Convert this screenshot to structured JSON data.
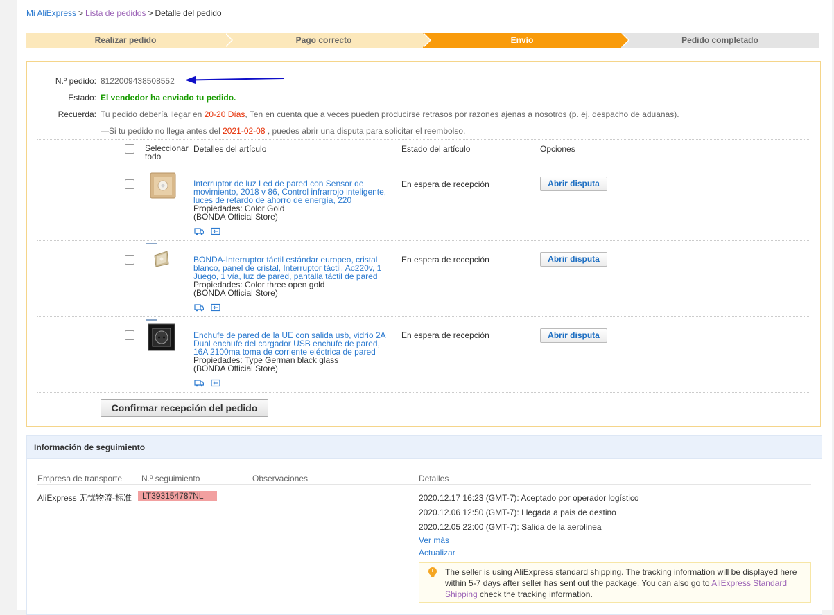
{
  "breadcrumb": {
    "home": "Mi AliExpress",
    "sep1": ">",
    "list": "Lista de pedidos",
    "sep2": ">",
    "current": "Detalle del pedido"
  },
  "steps": [
    {
      "label": "Realizar pedido",
      "state": "done"
    },
    {
      "label": "Pago correcto",
      "state": "done"
    },
    {
      "label": "Envío",
      "state": "active"
    },
    {
      "label": "Pedido completado",
      "state": "todo"
    }
  ],
  "order": {
    "number_label": "N.º pedido:",
    "number": "8122009438508552",
    "status_label": "Estado:",
    "status": "El vendedor ha enviado tu pedido.",
    "reminder_label": "Recuerda:",
    "reminder_pre": "Tu pedido debería llegar en ",
    "reminder_days": "20-20 Días",
    "reminder_post": ", Ten en cuenta que a veces pueden producirse retrasos por razones ajenas a nosotros (p. ej. despacho de aduanas).",
    "dispute_pre": "—Si tu pedido no llega antes del ",
    "dispute_date": "2021-02-08",
    "dispute_post": " , puedes abrir una disputa para solicitar el reembolso."
  },
  "table": {
    "select_all": "Seleccionar todo",
    "col_details": "Detalles del artículo",
    "col_status": "Estado del artículo",
    "col_options": "Opciones"
  },
  "items": [
    {
      "title": "Interruptor de luz Led de pared con Sensor de movimiento, 2018 v 86, Control infrarrojo inteligente, luces de retardo de ahorro de energía, 220",
      "props": "Propiedades: Color Gold",
      "store": "(BONDA Official Store)",
      "status": "En espera de recepción",
      "action": "Abrir disputa"
    },
    {
      "title": "BONDA-Interruptor táctil estándar europeo, cristal blanco, panel de cristal, Interruptor táctil, Ac220v, 1 Juego, 1 vía, luz de pared, pantalla táctil de pared",
      "props": "Propiedades: Color three open gold",
      "store": "(BONDA Official Store)",
      "status": "En espera de recepción",
      "action": "Abrir disputa"
    },
    {
      "title": "Enchufe de pared de la UE con salida usb, vidrio 2A Dual enchufe del cargador USB enchufe de pared, 16A 2100ma toma de corriente eléctrica de pared",
      "props": "Propiedades: Type German black glass",
      "store": "(BONDA Official Store)",
      "status": "En espera de recepción",
      "action": "Abrir disputa"
    }
  ],
  "confirm_button": "Confirmar recepción del pedido",
  "tracking": {
    "title": "Información de seguimiento",
    "col_carrier": "Empresa de transporte",
    "col_number": "N.º seguimiento",
    "col_notes": "Observaciones",
    "col_details": "Detalles",
    "carrier": "AliExpress 无忧物流-标准",
    "number": "LT393154787NL",
    "events": [
      "2020.12.17 16:23 (GMT-7): Aceptado por operador logístico",
      "2020.12.06 12:50 (GMT-7): Llegada a pais de destino",
      "2020.12.05 22:00 (GMT-7): Salida de la aerolinea"
    ],
    "more": "Ver más",
    "refresh": "Actualizar",
    "notice_pre": "The seller is using AliExpress standard shipping. The tracking information will be displayed here within 5-7 days after seller has sent out the package. You can also go to ",
    "notice_link": "AliExpress Standard Shipping",
    "notice_post": " check the tracking information."
  },
  "colors": {
    "step_done": "#fce8bb",
    "step_active": "#f99b0b",
    "step_todo": "#e4e4e4",
    "link": "#2d7bd0",
    "status_green": "#189b00",
    "highlight_red": "#e62e04",
    "annotation_arrow": "#1010c8",
    "tracking_highlight": "#f2a0a0"
  }
}
